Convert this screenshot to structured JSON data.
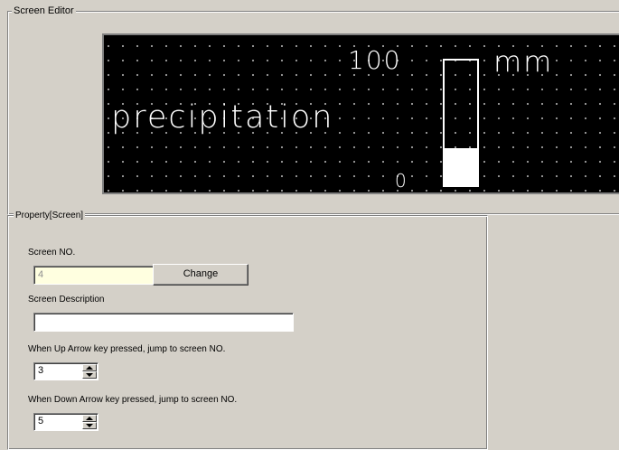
{
  "editor": {
    "title": "Screen Editor",
    "lcd": {
      "label": "precipitation",
      "max": "100",
      "unit": "mm",
      "min": "0",
      "bar_fill_fraction": 0.3
    }
  },
  "property": {
    "title": "Property[Screen]",
    "screen_no_label": "Screen NO.",
    "screen_no_value": "4",
    "change_label": "Change",
    "desc_label": "Screen Description",
    "desc_value": "",
    "up_label": "When Up Arrow key pressed, jump to screen NO.",
    "up_value": "3",
    "down_label": "When Down Arrow key pressed, jump to screen  NO.",
    "down_value": "5"
  }
}
